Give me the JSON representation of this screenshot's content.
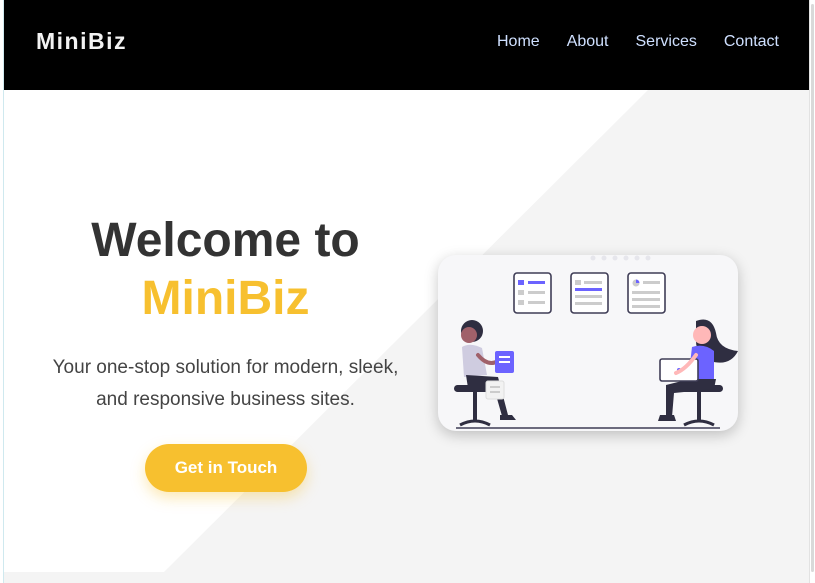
{
  "navbar": {
    "brand": "MiniBiz",
    "links": [
      {
        "label": "Home"
      },
      {
        "label": "About"
      },
      {
        "label": "Services"
      },
      {
        "label": "Contact"
      }
    ]
  },
  "hero": {
    "title_line1": "Welcome to",
    "title_line2": "MiniBiz",
    "subtitle_line1": "Your one-stop solution for modern, sleek,",
    "subtitle_line2": "and responsive business sites.",
    "cta_label": "Get in Touch",
    "illustration": "team-collaboration-illustration"
  },
  "colors": {
    "accent": "#f7c02f",
    "navbar_bg": "#000000",
    "nav_link": "#cfe0ff",
    "illustration_accent": "#6c63ff"
  }
}
